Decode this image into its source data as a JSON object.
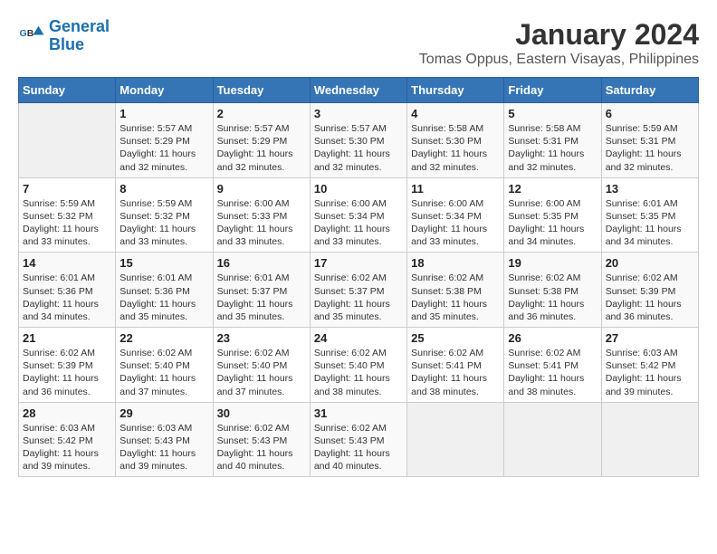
{
  "header": {
    "logo_line1": "General",
    "logo_line2": "Blue",
    "title": "January 2024",
    "subtitle": "Tomas Oppus, Eastern Visayas, Philippines"
  },
  "days_of_week": [
    "Sunday",
    "Monday",
    "Tuesday",
    "Wednesday",
    "Thursday",
    "Friday",
    "Saturday"
  ],
  "weeks": [
    [
      {
        "day": "",
        "info": ""
      },
      {
        "day": "1",
        "info": "Sunrise: 5:57 AM\nSunset: 5:29 PM\nDaylight: 11 hours and 32 minutes."
      },
      {
        "day": "2",
        "info": "Sunrise: 5:57 AM\nSunset: 5:29 PM\nDaylight: 11 hours and 32 minutes."
      },
      {
        "day": "3",
        "info": "Sunrise: 5:57 AM\nSunset: 5:30 PM\nDaylight: 11 hours and 32 minutes."
      },
      {
        "day": "4",
        "info": "Sunrise: 5:58 AM\nSunset: 5:30 PM\nDaylight: 11 hours and 32 minutes."
      },
      {
        "day": "5",
        "info": "Sunrise: 5:58 AM\nSunset: 5:31 PM\nDaylight: 11 hours and 32 minutes."
      },
      {
        "day": "6",
        "info": "Sunrise: 5:59 AM\nSunset: 5:31 PM\nDaylight: 11 hours and 32 minutes."
      }
    ],
    [
      {
        "day": "7",
        "info": "Sunrise: 5:59 AM\nSunset: 5:32 PM\nDaylight: 11 hours and 33 minutes."
      },
      {
        "day": "8",
        "info": "Sunrise: 5:59 AM\nSunset: 5:32 PM\nDaylight: 11 hours and 33 minutes."
      },
      {
        "day": "9",
        "info": "Sunrise: 6:00 AM\nSunset: 5:33 PM\nDaylight: 11 hours and 33 minutes."
      },
      {
        "day": "10",
        "info": "Sunrise: 6:00 AM\nSunset: 5:34 PM\nDaylight: 11 hours and 33 minutes."
      },
      {
        "day": "11",
        "info": "Sunrise: 6:00 AM\nSunset: 5:34 PM\nDaylight: 11 hours and 33 minutes."
      },
      {
        "day": "12",
        "info": "Sunrise: 6:00 AM\nSunset: 5:35 PM\nDaylight: 11 hours and 34 minutes."
      },
      {
        "day": "13",
        "info": "Sunrise: 6:01 AM\nSunset: 5:35 PM\nDaylight: 11 hours and 34 minutes."
      }
    ],
    [
      {
        "day": "14",
        "info": "Sunrise: 6:01 AM\nSunset: 5:36 PM\nDaylight: 11 hours and 34 minutes."
      },
      {
        "day": "15",
        "info": "Sunrise: 6:01 AM\nSunset: 5:36 PM\nDaylight: 11 hours and 35 minutes."
      },
      {
        "day": "16",
        "info": "Sunrise: 6:01 AM\nSunset: 5:37 PM\nDaylight: 11 hours and 35 minutes."
      },
      {
        "day": "17",
        "info": "Sunrise: 6:02 AM\nSunset: 5:37 PM\nDaylight: 11 hours and 35 minutes."
      },
      {
        "day": "18",
        "info": "Sunrise: 6:02 AM\nSunset: 5:38 PM\nDaylight: 11 hours and 35 minutes."
      },
      {
        "day": "19",
        "info": "Sunrise: 6:02 AM\nSunset: 5:38 PM\nDaylight: 11 hours and 36 minutes."
      },
      {
        "day": "20",
        "info": "Sunrise: 6:02 AM\nSunset: 5:39 PM\nDaylight: 11 hours and 36 minutes."
      }
    ],
    [
      {
        "day": "21",
        "info": "Sunrise: 6:02 AM\nSunset: 5:39 PM\nDaylight: 11 hours and 36 minutes."
      },
      {
        "day": "22",
        "info": "Sunrise: 6:02 AM\nSunset: 5:40 PM\nDaylight: 11 hours and 37 minutes."
      },
      {
        "day": "23",
        "info": "Sunrise: 6:02 AM\nSunset: 5:40 PM\nDaylight: 11 hours and 37 minutes."
      },
      {
        "day": "24",
        "info": "Sunrise: 6:02 AM\nSunset: 5:40 PM\nDaylight: 11 hours and 38 minutes."
      },
      {
        "day": "25",
        "info": "Sunrise: 6:02 AM\nSunset: 5:41 PM\nDaylight: 11 hours and 38 minutes."
      },
      {
        "day": "26",
        "info": "Sunrise: 6:02 AM\nSunset: 5:41 PM\nDaylight: 11 hours and 38 minutes."
      },
      {
        "day": "27",
        "info": "Sunrise: 6:03 AM\nSunset: 5:42 PM\nDaylight: 11 hours and 39 minutes."
      }
    ],
    [
      {
        "day": "28",
        "info": "Sunrise: 6:03 AM\nSunset: 5:42 PM\nDaylight: 11 hours and 39 minutes."
      },
      {
        "day": "29",
        "info": "Sunrise: 6:03 AM\nSunset: 5:43 PM\nDaylight: 11 hours and 39 minutes."
      },
      {
        "day": "30",
        "info": "Sunrise: 6:02 AM\nSunset: 5:43 PM\nDaylight: 11 hours and 40 minutes."
      },
      {
        "day": "31",
        "info": "Sunrise: 6:02 AM\nSunset: 5:43 PM\nDaylight: 11 hours and 40 minutes."
      },
      {
        "day": "",
        "info": ""
      },
      {
        "day": "",
        "info": ""
      },
      {
        "day": "",
        "info": ""
      }
    ]
  ]
}
